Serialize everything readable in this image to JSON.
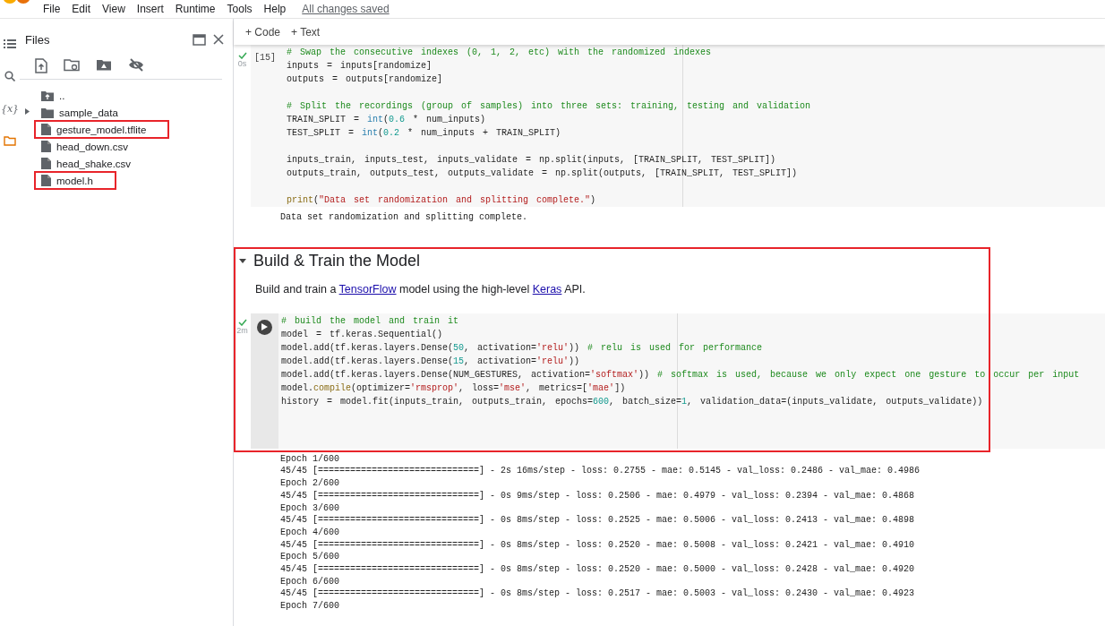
{
  "menu_bar": {
    "items": [
      "File",
      "Edit",
      "View",
      "Insert",
      "Runtime",
      "Tools",
      "Help"
    ],
    "save_status": "All changes saved"
  },
  "side_rail": {
    "items": [
      {
        "kind": "toc",
        "selected": false
      },
      {
        "kind": "search",
        "selected": false
      },
      {
        "kind": "variables",
        "label": "{x}",
        "selected": false
      },
      {
        "kind": "files",
        "selected": true
      }
    ]
  },
  "files_panel": {
    "title": "Files",
    "tree": [
      {
        "kind": "parent",
        "name": ".."
      },
      {
        "kind": "folder",
        "name": "sample_data",
        "expanded": false
      },
      {
        "kind": "file",
        "name": "gesture_model.tflite",
        "highlighted": true
      },
      {
        "kind": "file",
        "name": "head_down.csv",
        "highlighted": false
      },
      {
        "kind": "file",
        "name": "head_shake.csv",
        "highlighted": false
      },
      {
        "kind": "file",
        "name": "model.h",
        "highlighted": true
      }
    ]
  },
  "toolbar": {
    "buttons": [
      "+ Code",
      "+ Text"
    ]
  },
  "cells": [
    {
      "kind": "code",
      "succeeded": true,
      "duration": "0s",
      "exec_count": "[15]",
      "lines": [
        {
          "kind": "code",
          "tokens": [
            {
              "kind": "comment",
              "text": "# Swap the consecutive indexes (0, 1, 2, etc) with the randomized indexes"
            }
          ]
        },
        {
          "kind": "code",
          "tokens": [
            {
              "kind": "plain",
              "text": "inputs = inputs[randomize]"
            }
          ]
        },
        {
          "kind": "code",
          "tokens": [
            {
              "kind": "plain",
              "text": "outputs = outputs[randomize]"
            }
          ]
        },
        {
          "kind": "blank"
        },
        {
          "kind": "code",
          "tokens": [
            {
              "kind": "comment",
              "text": "# Split the recordings (group of samples) into three sets: training, testing and validation"
            }
          ]
        },
        {
          "kind": "code",
          "tokens": [
            {
              "kind": "plain",
              "text": "TRAIN_SPLIT = "
            },
            {
              "kind": "builtin",
              "text": "int"
            },
            {
              "kind": "plain",
              "text": "("
            },
            {
              "kind": "number",
              "text": "0.6"
            },
            {
              "kind": "plain",
              "text": " * num_inputs)"
            }
          ]
        },
        {
          "kind": "code",
          "tokens": [
            {
              "kind": "plain",
              "text": "TEST_SPLIT = "
            },
            {
              "kind": "builtin",
              "text": "int"
            },
            {
              "kind": "plain",
              "text": "("
            },
            {
              "kind": "number",
              "text": "0.2"
            },
            {
              "kind": "plain",
              "text": " * num_inputs + TRAIN_SPLIT)"
            }
          ]
        },
        {
          "kind": "blank"
        },
        {
          "kind": "code",
          "tokens": [
            {
              "kind": "plain",
              "text": "inputs_train, inputs_test, inputs_validate = np.split(inputs, [TRAIN_SPLIT, TEST_SPLIT])"
            }
          ]
        },
        {
          "kind": "code",
          "tokens": [
            {
              "kind": "plain",
              "text": "outputs_train, outputs_test, outputs_validate = np.split(outputs, [TRAIN_SPLIT, TEST_SPLIT])"
            }
          ]
        },
        {
          "kind": "blank"
        },
        {
          "kind": "code",
          "tokens": [
            {
              "kind": "function",
              "text": "print"
            },
            {
              "kind": "plain",
              "text": "("
            },
            {
              "kind": "string",
              "text": "\"Data set randomization and splitting complete.\""
            },
            {
              "kind": "plain",
              "text": ")"
            }
          ]
        }
      ],
      "output": [
        "Data set randomization and splitting complete."
      ]
    },
    {
      "kind": "section",
      "highlighted": true,
      "expanded": true,
      "heading": "Build & Train the Model",
      "intro": [
        {
          "kind": "text",
          "text": "Build and train a "
        },
        {
          "kind": "link",
          "text": "TensorFlow"
        },
        {
          "kind": "text",
          "text": " model using the high-level "
        },
        {
          "kind": "link",
          "text": "Keras"
        },
        {
          "kind": "text",
          "text": " API."
        }
      ],
      "cell": {
        "succeeded": true,
        "duration": "2m",
        "lines": [
          {
            "kind": "code",
            "tokens": [
              {
                "kind": "comment",
                "text": "# build the model and train it"
              }
            ]
          },
          {
            "kind": "code",
            "tokens": [
              {
                "kind": "plain",
                "text": "model = tf.keras.Sequential()"
              }
            ]
          },
          {
            "kind": "code",
            "tokens": [
              {
                "kind": "plain",
                "text": "model.add(tf.keras.layers.Dense("
              },
              {
                "kind": "number",
                "text": "50"
              },
              {
                "kind": "plain",
                "text": ", activation="
              },
              {
                "kind": "string",
                "text": "'relu'"
              },
              {
                "kind": "plain",
                "text": ")) "
              },
              {
                "kind": "comment",
                "text": "# relu is used for performance"
              }
            ]
          },
          {
            "kind": "code",
            "tokens": [
              {
                "kind": "plain",
                "text": "model.add(tf.keras.layers.Dense("
              },
              {
                "kind": "number",
                "text": "15"
              },
              {
                "kind": "plain",
                "text": ", activation="
              },
              {
                "kind": "string",
                "text": "'relu'"
              },
              {
                "kind": "plain",
                "text": "))"
              }
            ]
          },
          {
            "kind": "code",
            "tokens": [
              {
                "kind": "plain",
                "text": "model.add(tf.keras.layers.Dense(NUM_GESTURES, activation="
              },
              {
                "kind": "string",
                "text": "'softmax'"
              },
              {
                "kind": "plain",
                "text": ")) "
              },
              {
                "kind": "comment",
                "text": "# softmax is used, because we only expect one gesture to occur per input"
              }
            ]
          },
          {
            "kind": "code",
            "tokens": [
              {
                "kind": "plain",
                "text": "model."
              },
              {
                "kind": "function",
                "text": "compile"
              },
              {
                "kind": "plain",
                "text": "(optimizer="
              },
              {
                "kind": "string",
                "text": "'rmsprop'"
              },
              {
                "kind": "plain",
                "text": ", loss="
              },
              {
                "kind": "string",
                "text": "'mse'"
              },
              {
                "kind": "plain",
                "text": ", metrics=["
              },
              {
                "kind": "string",
                "text": "'mae'"
              },
              {
                "kind": "plain",
                "text": "])"
              }
            ]
          },
          {
            "kind": "code",
            "tokens": [
              {
                "kind": "plain",
                "text": "history = model.fit(inputs_train, outputs_train, epochs="
              },
              {
                "kind": "number",
                "text": "600"
              },
              {
                "kind": "plain",
                "text": ", batch_size="
              },
              {
                "kind": "number",
                "text": "1"
              },
              {
                "kind": "plain",
                "text": ", validation_data=(inputs_validate, outputs_validate))"
              }
            ]
          }
        ],
        "output": [
          "Epoch 1/600",
          "45/45 [==============================] - 2s 16ms/step - loss: 0.2755 - mae: 0.5145 - val_loss: 0.2486 - val_mae: 0.4986",
          "Epoch 2/600",
          "45/45 [==============================] - 0s 9ms/step - loss: 0.2506 - mae: 0.4979 - val_loss: 0.2394 - val_mae: 0.4868",
          "Epoch 3/600",
          "45/45 [==============================] - 0s 8ms/step - loss: 0.2525 - mae: 0.5006 - val_loss: 0.2413 - val_mae: 0.4898",
          "Epoch 4/600",
          "45/45 [==============================] - 0s 8ms/step - loss: 0.2520 - mae: 0.5008 - val_loss: 0.2421 - val_mae: 0.4910",
          "Epoch 5/600",
          "45/45 [==============================] - 0s 8ms/step - loss: 0.2520 - mae: 0.5000 - val_loss: 0.2428 - val_mae: 0.4920",
          "Epoch 6/600",
          "45/45 [==============================] - 0s 8ms/step - loss: 0.2517 - mae: 0.5003 - val_loss: 0.2430 - val_mae: 0.4923",
          "Epoch 7/600"
        ]
      }
    }
  ]
}
